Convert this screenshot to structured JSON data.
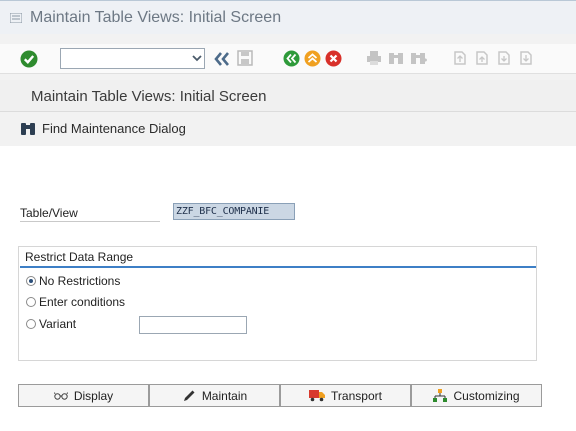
{
  "window": {
    "title": "Maintain Table Views: Initial Screen"
  },
  "screen": {
    "title": "Maintain Table Views: Initial Screen"
  },
  "app_toolbar": {
    "find_label": "Find Maintenance Dialog"
  },
  "form": {
    "table_view_label": "Table/View",
    "table_view_value": "ZZF_BFC_COMPANIE"
  },
  "restrict": {
    "title": "Restrict Data Range",
    "options": [
      {
        "label": "No Restrictions",
        "selected": true
      },
      {
        "label": "Enter conditions",
        "selected": false
      },
      {
        "label": "Variant",
        "selected": false
      }
    ],
    "variant_value": ""
  },
  "buttons": {
    "display": "Display",
    "maintain": "Maintain",
    "transport": "Transport",
    "customizing": "Customizing"
  },
  "colors": {
    "ok_green": "#2e8b2e",
    "back_green": "#2e9a3a",
    "exit_orange": "#f0a020",
    "cancel_red": "#d8302a",
    "accent_blue": "#3d7fc6"
  },
  "icons": [
    "menu-icon",
    "enter-icon",
    "back-arrows-icon",
    "save-icon",
    "back-icon",
    "exit-icon",
    "cancel-icon",
    "print-icon",
    "find-icon",
    "find-next-icon",
    "first-page-icon",
    "previous-page-icon",
    "next-page-icon",
    "last-page-icon",
    "binoculars-icon",
    "glasses-icon",
    "pencil-icon",
    "truck-icon",
    "hierarchy-icon"
  ]
}
